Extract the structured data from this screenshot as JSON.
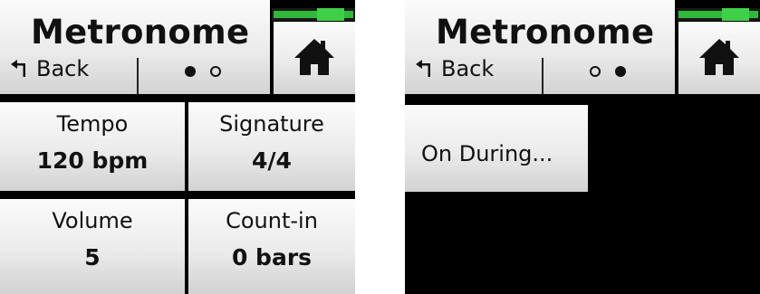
{
  "screens": [
    {
      "title": "Metronome",
      "back_label": "Back",
      "page_index": 0,
      "tiles": [
        {
          "label": "Tempo",
          "value": "120 bpm"
        },
        {
          "label": "Signature",
          "value": "4/4"
        },
        {
          "label": "Volume",
          "value": "5"
        },
        {
          "label": "Count-in",
          "value": "0 bars"
        }
      ]
    },
    {
      "title": "Metronome",
      "back_label": "Back",
      "page_index": 1,
      "tiles": [
        {
          "label": "On During..."
        }
      ]
    }
  ],
  "icons": {
    "back": "back-arrow-icon",
    "home": "home-icon",
    "battery": "battery-level-icon",
    "page_on": "page-dot-filled-icon",
    "page_off": "page-dot-empty-icon"
  },
  "colors": {
    "background": "#000000",
    "tile_top": "#fbfbfb",
    "tile_bottom": "#d2d2d2",
    "text": "#111111",
    "battery_green": "#2fb83a"
  }
}
